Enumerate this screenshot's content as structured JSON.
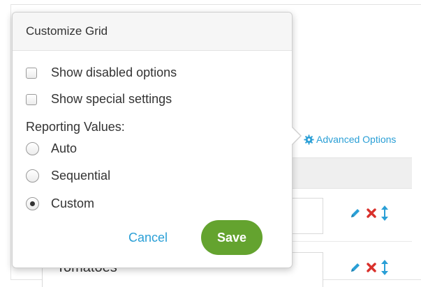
{
  "popover": {
    "title": "Customize Grid",
    "options": [
      {
        "label": "Show disabled options",
        "checked": false
      },
      {
        "label": "Show special settings",
        "checked": false
      }
    ],
    "reporting_label": "Reporting Values:",
    "reporting_values": [
      {
        "label": "Auto",
        "selected": false
      },
      {
        "label": "Sequential",
        "selected": false
      },
      {
        "label": "Custom",
        "selected": true
      }
    ],
    "cancel_label": "Cancel",
    "save_label": "Save"
  },
  "page": {
    "advanced_options_label": "Advanced Options",
    "rows": [
      {
        "value": ""
      },
      {
        "value": "Tomatoes"
      }
    ]
  },
  "colors": {
    "accent_blue": "#2a9fd6",
    "save_green": "#64a32f",
    "delete_red": "#d9302b"
  }
}
